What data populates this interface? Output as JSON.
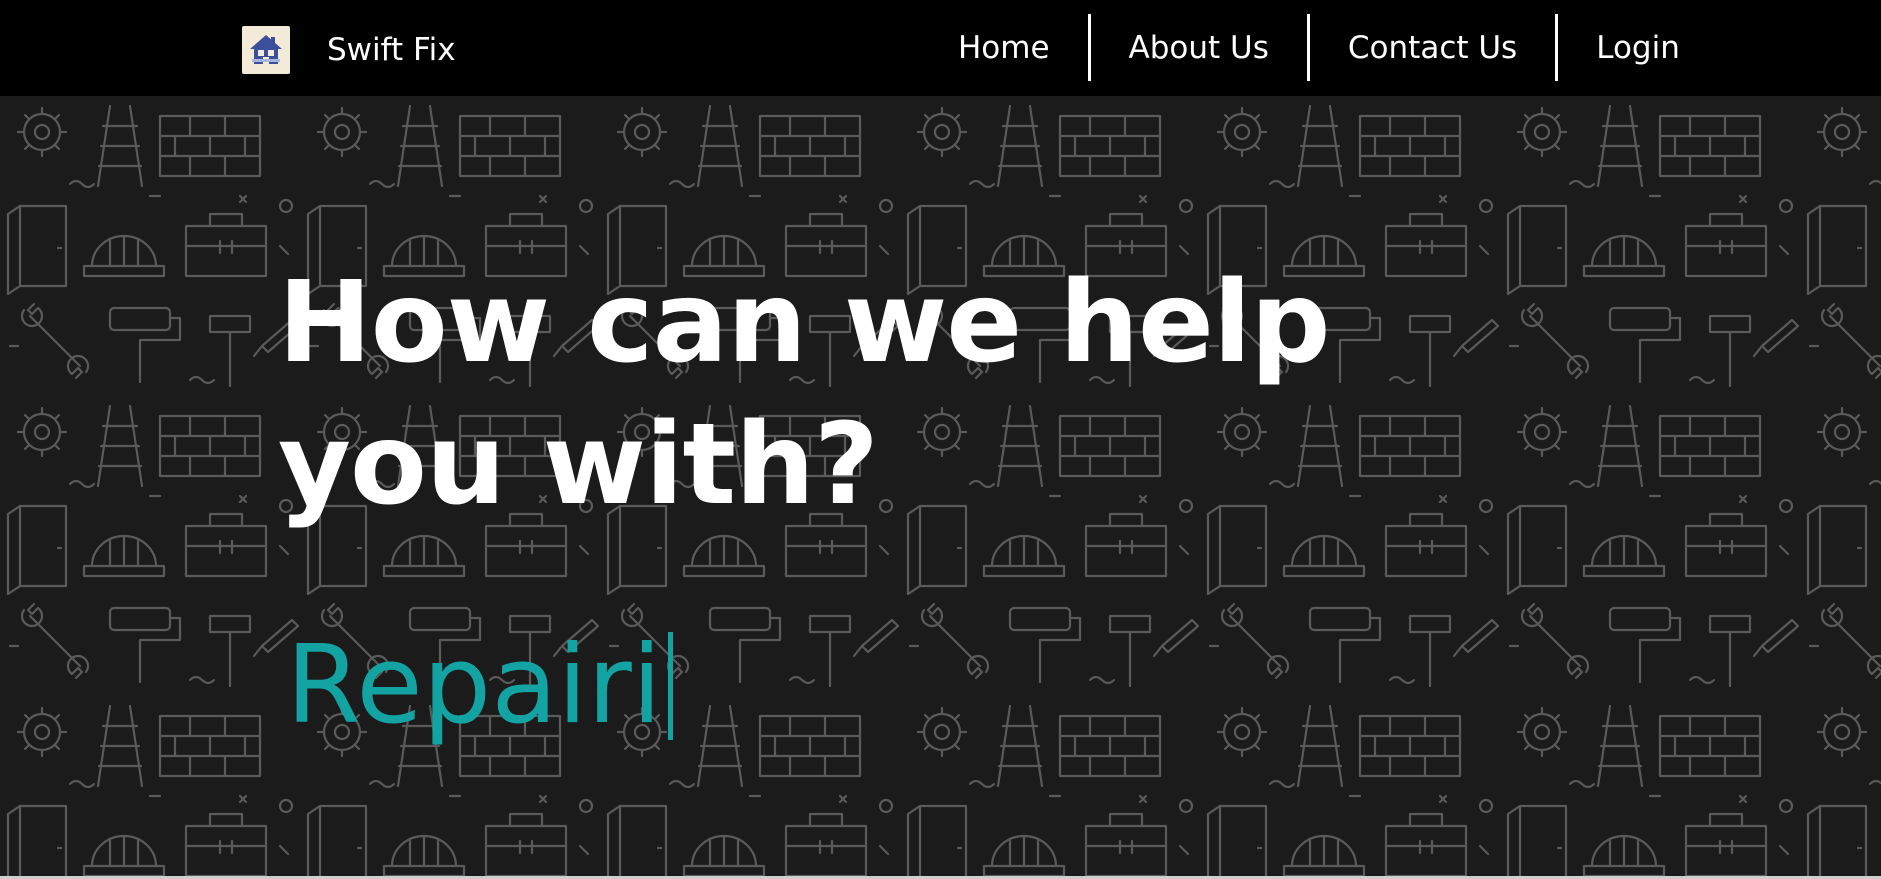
{
  "header": {
    "brand_name": "Swift Fix",
    "logo_icon": "house-icon",
    "nav": [
      {
        "label": "Home"
      },
      {
        "label": "About Us"
      },
      {
        "label": "Contact Us"
      },
      {
        "label": "Login"
      }
    ]
  },
  "hero": {
    "headline": "How can we help you with?",
    "typed_text": "Repairi",
    "background_pattern": "construction-tools-pattern"
  },
  "colors": {
    "navbar_bg": "#000000",
    "hero_bg": "#1b1b1b",
    "pattern_line": "#5a5a5a",
    "text": "#ffffff",
    "accent": "#14a3a3",
    "logo_bg": "#f3ead8",
    "logo_house": "#3b4f9c"
  }
}
